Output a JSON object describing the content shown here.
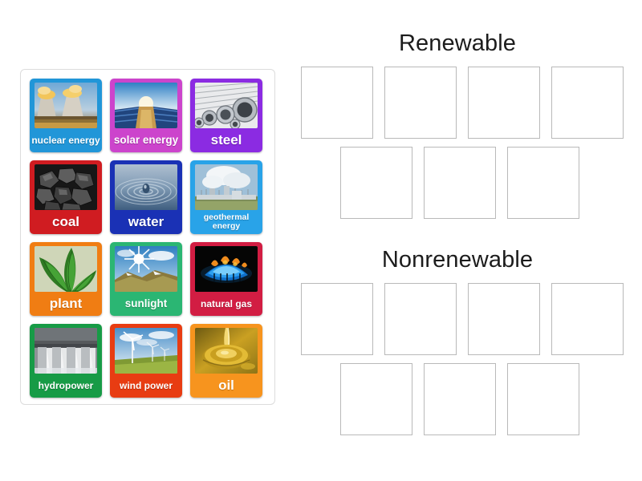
{
  "activity": {
    "type": "group-sort",
    "background_color": "#ffffff"
  },
  "tray": {
    "name": "source-card-tray",
    "border_color": "#dcdcdc",
    "columns": 3,
    "rows": 4,
    "cards": [
      {
        "label": "nuclear energy",
        "color": "#2196d8",
        "icon": "cooling-towers-image",
        "size": "sm",
        "lines": 1
      },
      {
        "label": "solar energy",
        "color": "#cc44cc",
        "icon": "solar-panels-image",
        "size": "md",
        "lines": 1
      },
      {
        "label": "steel",
        "color": "#8b2be2",
        "icon": "steel-pipes-image",
        "size": "lg",
        "lines": 1
      },
      {
        "label": "coal",
        "color": "#d01c21",
        "icon": "coal-lumps-image",
        "size": "lg",
        "lines": 1
      },
      {
        "label": "water",
        "color": "#1a31b5",
        "icon": "water-droplet-image",
        "size": "lg",
        "lines": 1
      },
      {
        "label": "geothermal energy",
        "color": "#29a3e8",
        "icon": "power-plant-image",
        "size": "xs",
        "lines": 2
      },
      {
        "label": "plant",
        "color": "#f07d13",
        "icon": "green-leaves-image",
        "size": "lg",
        "lines": 1
      },
      {
        "label": "sunlight",
        "color": "#2bb673",
        "icon": "sun-over-hills-image",
        "size": "md",
        "lines": 1
      },
      {
        "label": "natural gas",
        "color": "#d21d43",
        "icon": "gas-flame-image",
        "size": "sm",
        "lines": 1
      },
      {
        "label": "hydropower",
        "color": "#179b46",
        "icon": "dam-spillway-image",
        "size": "sm",
        "lines": 1
      },
      {
        "label": "wind power",
        "color": "#e83c12",
        "icon": "wind-turbines-image",
        "size": "sm",
        "lines": 1
      },
      {
        "label": "oil",
        "color": "#f7941e",
        "icon": "pouring-oil-image",
        "size": "lg",
        "lines": 1
      }
    ]
  },
  "zones": [
    {
      "title": "Renewable",
      "name": "renewable",
      "row1_slots": 4,
      "row2_slots": 3,
      "slot_border_color": "#b9b9b9"
    },
    {
      "title": "Nonrenewable",
      "name": "nonrenewable",
      "row1_slots": 4,
      "row2_slots": 3,
      "slot_border_color": "#b9b9b9"
    }
  ]
}
